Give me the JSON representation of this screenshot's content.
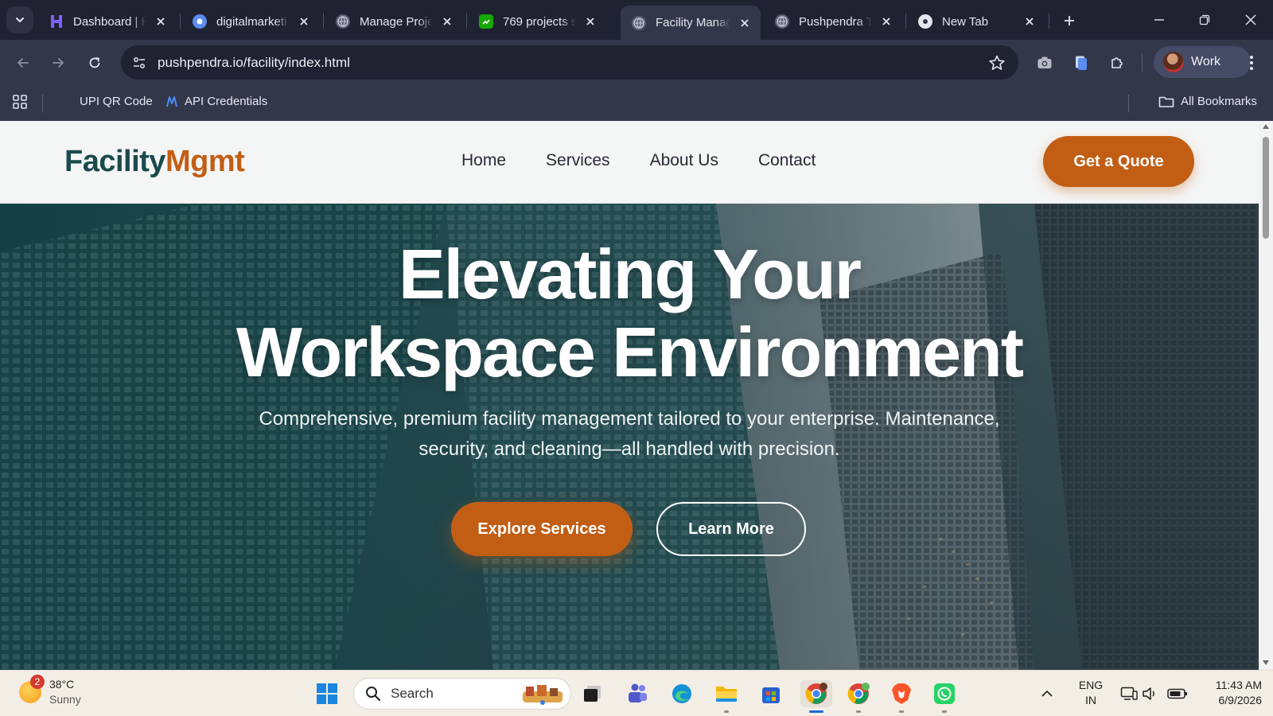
{
  "browser": {
    "tabs": [
      {
        "label": "Dashboard | H",
        "icon": "hostinger-icon",
        "active": false
      },
      {
        "label": "digitalmarketi",
        "icon": "site-icon",
        "active": false
      },
      {
        "label": "Manage Proje",
        "icon": "globe-icon",
        "active": false
      },
      {
        "label": "769 projects s",
        "icon": "upwork-icon",
        "active": false
      },
      {
        "label": "Facility Manag",
        "icon": "globe-icon",
        "active": true
      },
      {
        "label": "Pushpendra T",
        "icon": "globe-icon",
        "active": false
      },
      {
        "label": "New Tab",
        "icon": "chrome-icon",
        "active": false
      }
    ],
    "address": "pushpendra.io/facility/index.html",
    "profile_label": "Work",
    "bookmarks": [
      {
        "label": "UPI QR Code"
      },
      {
        "label": "API Credentials"
      }
    ],
    "all_bookmarks_label": "All Bookmarks"
  },
  "site": {
    "logo_part1": "Facility",
    "logo_part2": "Mgmt",
    "nav": [
      {
        "label": "Home"
      },
      {
        "label": "Services"
      },
      {
        "label": "About Us"
      },
      {
        "label": "Contact"
      }
    ],
    "quote_button": "Get a Quote",
    "hero": {
      "title_line1": "Elevating Your",
      "title_line2": "Workspace Environment",
      "subtitle": "Comprehensive, premium facility management tailored to your enterprise. Maintenance, security, and cleaning—all handled with precision.",
      "primary_button": "Explore Services",
      "secondary_button": "Learn More"
    }
  },
  "taskbar": {
    "weather_temp": "38°C",
    "weather_condition": "Sunny",
    "weather_badge": "2",
    "search_placeholder": "Search",
    "lang_line1": "ENG",
    "lang_line2": "IN",
    "time": "11:43 AM",
    "date": "6/9/2026"
  },
  "colors": {
    "brand_dark": "#1b4a4c",
    "brand_accent": "#c25e14",
    "browser_frame": "#1f2231",
    "browser_toolbar": "#33374a"
  }
}
